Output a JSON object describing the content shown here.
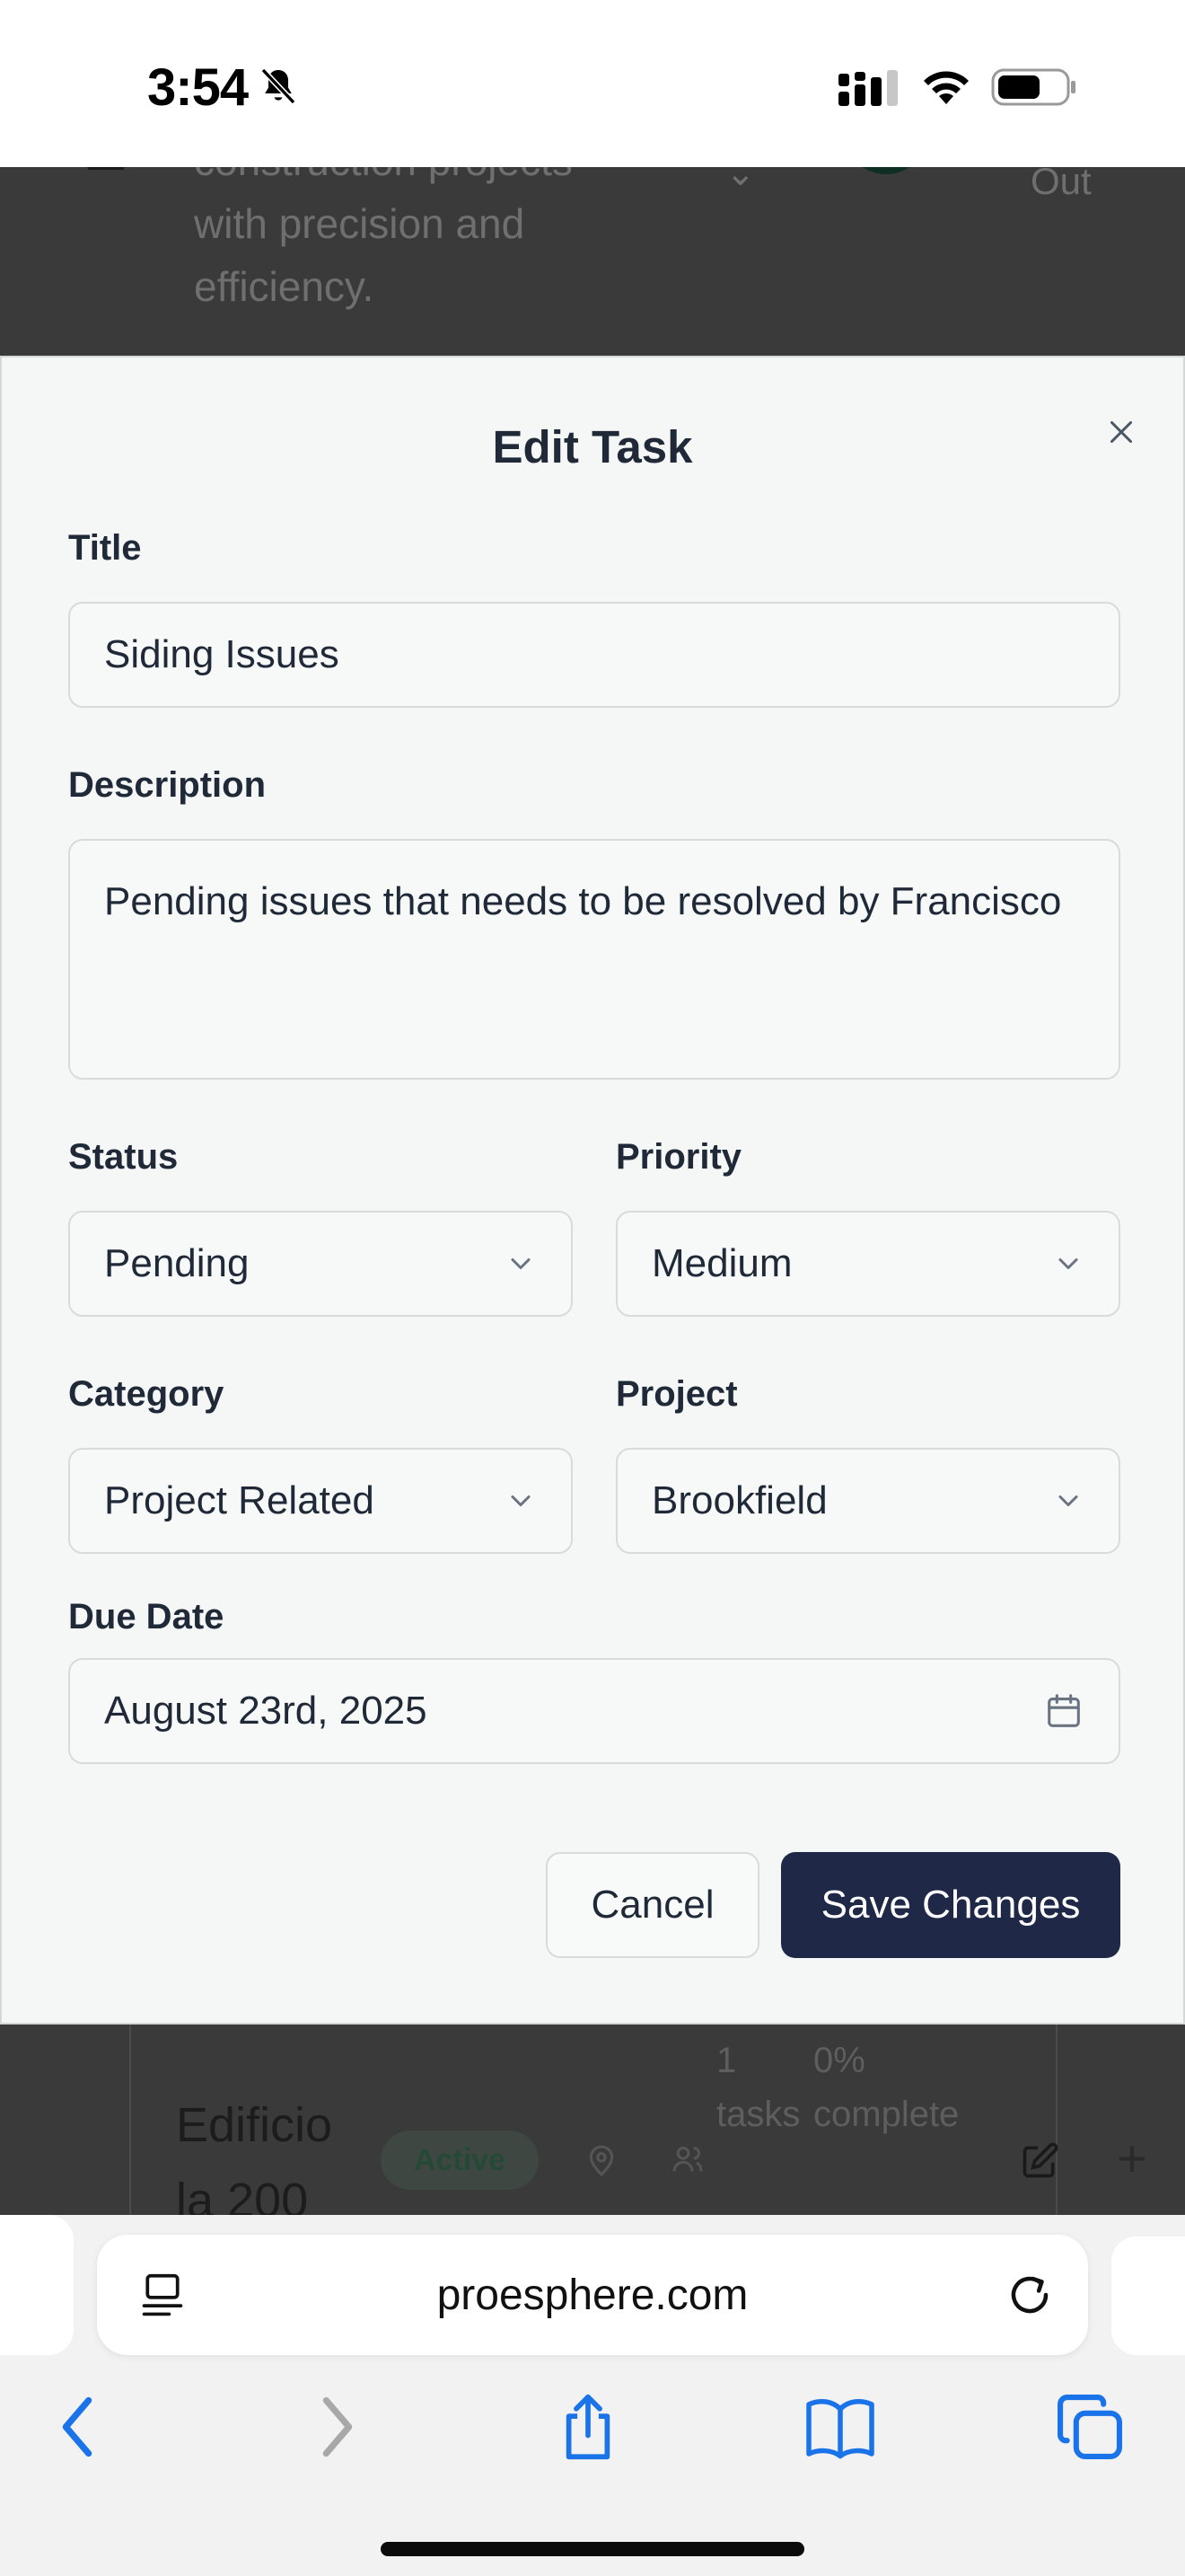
{
  "status_bar": {
    "time": "3:54",
    "icons": [
      "bell-slash-icon",
      "cellular-signal-icon",
      "wifi-icon",
      "battery-icon"
    ]
  },
  "background_page": {
    "description_lines": [
      "construction projects",
      "with precision and",
      "efficiency."
    ],
    "user_button_partial": "Out",
    "project_card": {
      "name_lines": [
        "Edificio",
        "la 200"
      ],
      "status_badge": "Active",
      "tasks_count": "1",
      "tasks_label": "tasks",
      "progress_value": "0%",
      "progress_label": "complete"
    }
  },
  "modal": {
    "title": "Edit Task",
    "fields": {
      "title": {
        "label": "Title",
        "value": "Siding Issues"
      },
      "description": {
        "label": "Description",
        "value": "Pending issues that needs to be resolved by Francisco"
      },
      "status": {
        "label": "Status",
        "value": "Pending"
      },
      "priority": {
        "label": "Priority",
        "value": "Medium"
      },
      "category": {
        "label": "Category",
        "value": "Project Related"
      },
      "project": {
        "label": "Project",
        "value": "Brookfield"
      },
      "due_date": {
        "label": "Due Date",
        "value": "August 23rd, 2025"
      }
    },
    "buttons": {
      "cancel": "Cancel",
      "save": "Save Changes"
    }
  },
  "browser": {
    "url": "proesphere.com",
    "toolbar_icons": [
      "back-icon",
      "forward-icon",
      "share-icon",
      "bookmarks-icon",
      "tabs-icon"
    ]
  },
  "colors": {
    "primary_button": "#1f2947",
    "modal_background": "#f5f7f6",
    "overlay": "#3a3a3a",
    "link_blue": "#1a73e8"
  }
}
